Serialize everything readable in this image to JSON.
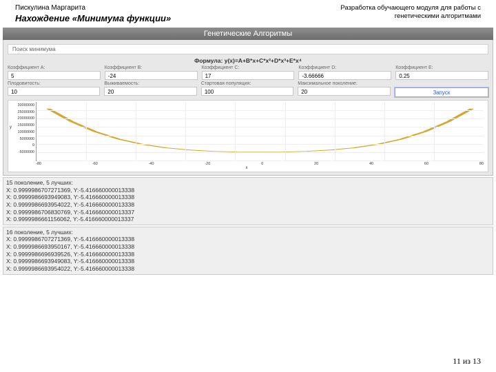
{
  "header": {
    "author": "Пискулина Маргарита",
    "slide_title": "Нахождение «Минимума функции»",
    "project": "Разработка обучающего модуля для работы с генетическими алгоритмами"
  },
  "app": {
    "title": "Генетические Алгоритмы",
    "tab_label": "Поиск минимума",
    "formula_label": "Формула: y(x)=A+B*x+C*x²+D*x³+E*x⁴",
    "fields_row1": {
      "a": {
        "label": "Коэффициент A:",
        "value": "5"
      },
      "b": {
        "label": "Коэффициент B:",
        "value": "-24"
      },
      "c": {
        "label": "Коэффициент C:",
        "value": "17"
      },
      "d": {
        "label": "Коэффициент D:",
        "value": "-3.66666"
      },
      "e": {
        "label": "Коэффициент E:",
        "value": "0.25"
      }
    },
    "fields_row2": {
      "fert": {
        "label": "Плодовитость:",
        "value": "10"
      },
      "surv": {
        "label": "Выживаемость:",
        "value": "20"
      },
      "pop": {
        "label": "Стартовая популяция:",
        "value": "100"
      },
      "gen": {
        "label": "Максимальное поколение:",
        "value": "20"
      }
    },
    "run_button": "Запуск"
  },
  "chart_data": {
    "type": "line",
    "x": [
      -90,
      -80,
      -70,
      -60,
      -50,
      -40,
      -30,
      -20,
      -10,
      0,
      10,
      20,
      30,
      40,
      50,
      60,
      70,
      80,
      90
    ],
    "y": [
      26000000,
      18250000,
      12250000,
      7800000,
      4700000,
      2600000,
      1300000,
      500000,
      100000,
      5,
      100000,
      500000,
      1300000,
      2600000,
      4700000,
      7800000,
      12250000,
      18250000,
      26000000
    ],
    "xlabel": "x",
    "ylabel": "y",
    "xlim": [
      -95,
      95
    ],
    "ylim": [
      -5000000,
      30000000
    ],
    "y_ticks": [
      "30000000",
      "25000000",
      "20000000",
      "15000000",
      "10000000",
      "5000000",
      "0",
      "-5000000"
    ],
    "x_ticks": [
      "-80",
      "-60",
      "-40",
      "-20",
      "0",
      "20",
      "40",
      "60",
      "80"
    ]
  },
  "results": {
    "block1": {
      "header": "15 поколение, 5 лучших:",
      "lines": [
        "X: 0.9999986707271369, Y:-5.416660000013338",
        "X: 0.9999986693949083, Y:-5.416660000013338",
        "X: 0.9999986693954022, Y:-5.416660000013338",
        "X: 0.9999986706830769, Y:-5.416660000013337",
        "X: 0.9999986661156062, Y:-5.416660000013337"
      ]
    },
    "block2": {
      "header": "16 поколение, 5 лучших:",
      "lines": [
        "X: 0.9999986707271369, Y:-5.416660000013338",
        "X: 0.9999986693950167, Y:-5.416660000013338",
        "X: 0.9999986696939526, Y:-5.416660000013338",
        "X: 0.9999986693949083, Y:-5.416660000013338",
        "X: 0.9999986693954022, Y:-5.416660000013338"
      ]
    }
  },
  "page": "11 из 13"
}
